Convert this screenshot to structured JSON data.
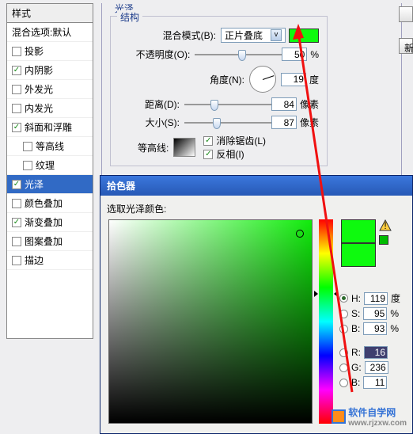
{
  "styles": {
    "header": "样式",
    "blend_default": "混合选项:默认",
    "items": [
      {
        "label": "投影",
        "checked": false,
        "selected": false
      },
      {
        "label": "内阴影",
        "checked": true,
        "selected": false
      },
      {
        "label": "外发光",
        "checked": false,
        "selected": false
      },
      {
        "label": "内发光",
        "checked": false,
        "selected": false
      },
      {
        "label": "斜面和浮雕",
        "checked": true,
        "selected": false
      },
      {
        "label": "等高线",
        "checked": false,
        "selected": false,
        "indent": true
      },
      {
        "label": "纹理",
        "checked": false,
        "selected": false,
        "indent": true
      },
      {
        "label": "光泽",
        "checked": true,
        "selected": true
      },
      {
        "label": "颜色叠加",
        "checked": false,
        "selected": false
      },
      {
        "label": "渐变叠加",
        "checked": true,
        "selected": false
      },
      {
        "label": "图案叠加",
        "checked": false,
        "selected": false
      },
      {
        "label": "描边",
        "checked": false,
        "selected": false
      }
    ]
  },
  "structure": {
    "group_label": "光泽",
    "inner_label": "结构",
    "blend_mode_label": "混合模式(B):",
    "blend_mode_value": "正片叠底",
    "opacity_label": "不透明度(O):",
    "opacity_value": "50",
    "opacity_unit": "%",
    "angle_label": "角度(N):",
    "angle_value": "19",
    "angle_unit": "度",
    "distance_label": "距离(D):",
    "distance_value": "84",
    "distance_unit": "像素",
    "size_label": "大小(S):",
    "size_value": "87",
    "size_unit": "像素",
    "contour_label": "等高线:",
    "antialias_label": "消除锯齿(L)",
    "invert_label": "反相(I)",
    "swatch_color": "#0EFA0E"
  },
  "buttons": {
    "new": "新"
  },
  "picker": {
    "title": "拾色器",
    "prompt": "选取光泽颜色:",
    "H": {
      "label": "H:",
      "value": "119",
      "unit": "度"
    },
    "S": {
      "label": "S:",
      "value": "95",
      "unit": "%"
    },
    "B": {
      "label": "B:",
      "value": "93",
      "unit": "%"
    },
    "R": {
      "label": "R:",
      "value": "16"
    },
    "G": {
      "label": "G:",
      "value": "236"
    },
    "Bb": {
      "label": "B:",
      "value": "11"
    }
  },
  "watermark": {
    "text": "软件自学网",
    "url": "www.rjzxw.com"
  }
}
